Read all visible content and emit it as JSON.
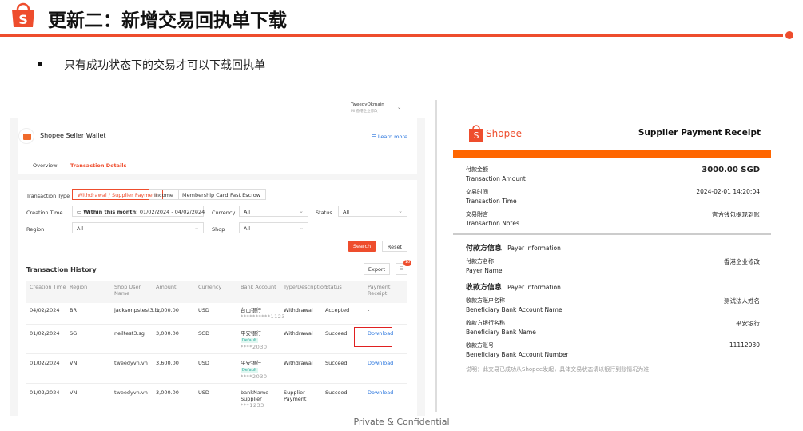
{
  "slide": {
    "title": "更新二：新增交易回执单下载",
    "bullet": "只有成功状态下的交易才可以下载回执单",
    "footer": "Private & Confidential"
  },
  "wallet": {
    "user": {
      "name": "TweedyOkmain",
      "sub": "Mi 香港企业修改"
    },
    "app_title": "Shopee Seller Wallet",
    "learn_more": "Learn more",
    "tabs": [
      "Overview",
      "Transaction Details"
    ],
    "filters": {
      "type_label": "Transaction Type",
      "types": [
        "Withdrawal / Supplier Payment",
        "Income",
        "Membership Card",
        "Fast Escrow"
      ],
      "creation_label": "Creation Time",
      "creation_prefix": "Within this month:",
      "creation_value": "01/02/2024 - 04/02/2024",
      "currency_label": "Currency",
      "currency_value": "All",
      "status_label": "Status",
      "status_value": "All",
      "region_label": "Region",
      "region_value": "All",
      "shop_label": "Shop",
      "shop_value": "All",
      "search": "Search",
      "reset": "Reset"
    },
    "history": {
      "title": "Transaction History",
      "export": "Export",
      "badge": "10",
      "columns": [
        "Creation Time",
        "Region",
        "Shop User Name",
        "Amount",
        "Currency",
        "Bank Account",
        "Type/Description",
        "Status",
        "Payment Receipt"
      ],
      "rows": [
        {
          "time": "04/02/2024",
          "region": "BR",
          "shop": "jacksonpstest3.br",
          "amount": "1,000.00",
          "currency": "USD",
          "bank": "台山银行",
          "default": "",
          "mask": "**********1123",
          "type": "Withdrawal",
          "status": "Accepted",
          "receipt": "-"
        },
        {
          "time": "01/02/2024",
          "region": "SG",
          "shop": "neiltest3.sg",
          "amount": "3,000.00",
          "currency": "SGD",
          "bank": "平安银行",
          "default": "Default",
          "mask": "****2030",
          "type": "Withdrawal",
          "status": "Succeed",
          "receipt": "Download"
        },
        {
          "time": "01/02/2024",
          "region": "VN",
          "shop": "tweedyvn.vn",
          "amount": "3,600.00",
          "currency": "USD",
          "bank": "平安银行",
          "default": "Default",
          "mask": "****2030",
          "type": "Withdrawal",
          "status": "Succeed",
          "receipt": "Download"
        },
        {
          "time": "01/02/2024",
          "region": "VN",
          "shop": "tweedyvn.vn",
          "amount": "3,000.00",
          "currency": "USD",
          "bank": "bankName Supplier",
          "default": "",
          "mask": "***1233",
          "type": "Supplier Payment",
          "status": "Succeed",
          "receipt": "Download"
        }
      ]
    }
  },
  "receipt": {
    "brand": "Shopee",
    "title": "Supplier Payment Receipt",
    "fields": [
      {
        "cn": "付款金额",
        "en": "Transaction Amount",
        "value": "3000.00 SGD"
      },
      {
        "cn": "交易时间",
        "en": "Transaction Time",
        "value": "2024-02-01 14:20:04"
      },
      {
        "cn": "交易附言",
        "en": "Transaction Notes",
        "value": "官方钱包提现到账"
      }
    ],
    "payer_section": {
      "cn": "付款方信息",
      "en": "Payer Information"
    },
    "payer_fields": [
      {
        "cn": "付款方名称",
        "en": "Payer Name",
        "value": "香港企业修改"
      }
    ],
    "payee_section": {
      "cn": "收款方信息",
      "en": "Payer Information"
    },
    "payee_fields": [
      {
        "cn": "收款方账户名称",
        "en": "Beneficiary Bank Account Name",
        "value": "测试法人姓名"
      },
      {
        "cn": "收款方银行名称",
        "en": "Beneficiary Bank Name",
        "value": "平安银行"
      },
      {
        "cn": "收款方账号",
        "en": "Beneficiary Bank Account Number",
        "value": "11112030"
      }
    ],
    "note": "说明：此交易已成功从Shopee发起，具体交易状态请以银行到账情况为准"
  },
  "colors": {
    "accent": "#ee4d2d",
    "receipt_bar": "#ff6600",
    "link": "#2673dd"
  }
}
